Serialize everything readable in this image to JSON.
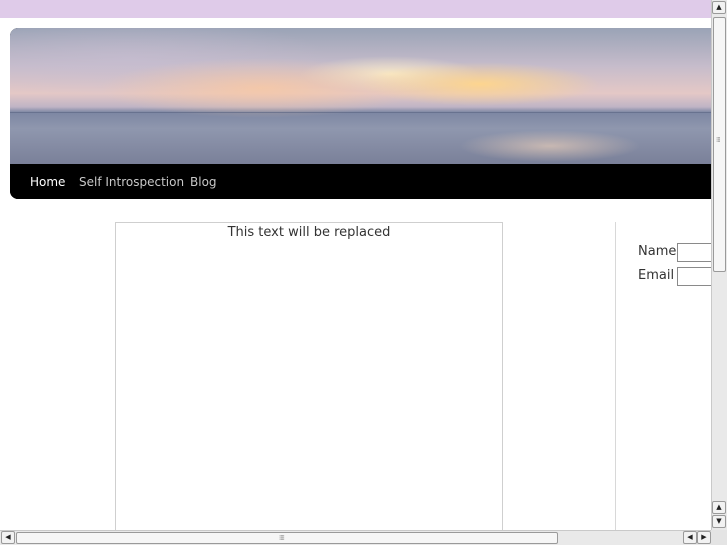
{
  "nav": {
    "items": [
      {
        "label": "Home",
        "active": true
      },
      {
        "label": "Self Introspection",
        "active": false
      },
      {
        "label": "Blog",
        "active": false
      }
    ]
  },
  "content": {
    "placeholder_text": "This text will be replaced"
  },
  "form": {
    "name_label": "Name",
    "email_label": "Email",
    "name_value": "",
    "email_value": ""
  },
  "colors": {
    "top_band": "#dfcbe9",
    "nav_background": "#000000",
    "nav_text": "#c8c8c8",
    "nav_active_text": "#ffffff"
  },
  "icons": {
    "scroll_up": "arrow-up-icon",
    "scroll_down": "arrow-down-icon",
    "scroll_left": "arrow-left-icon",
    "scroll_right": "arrow-right-icon"
  }
}
